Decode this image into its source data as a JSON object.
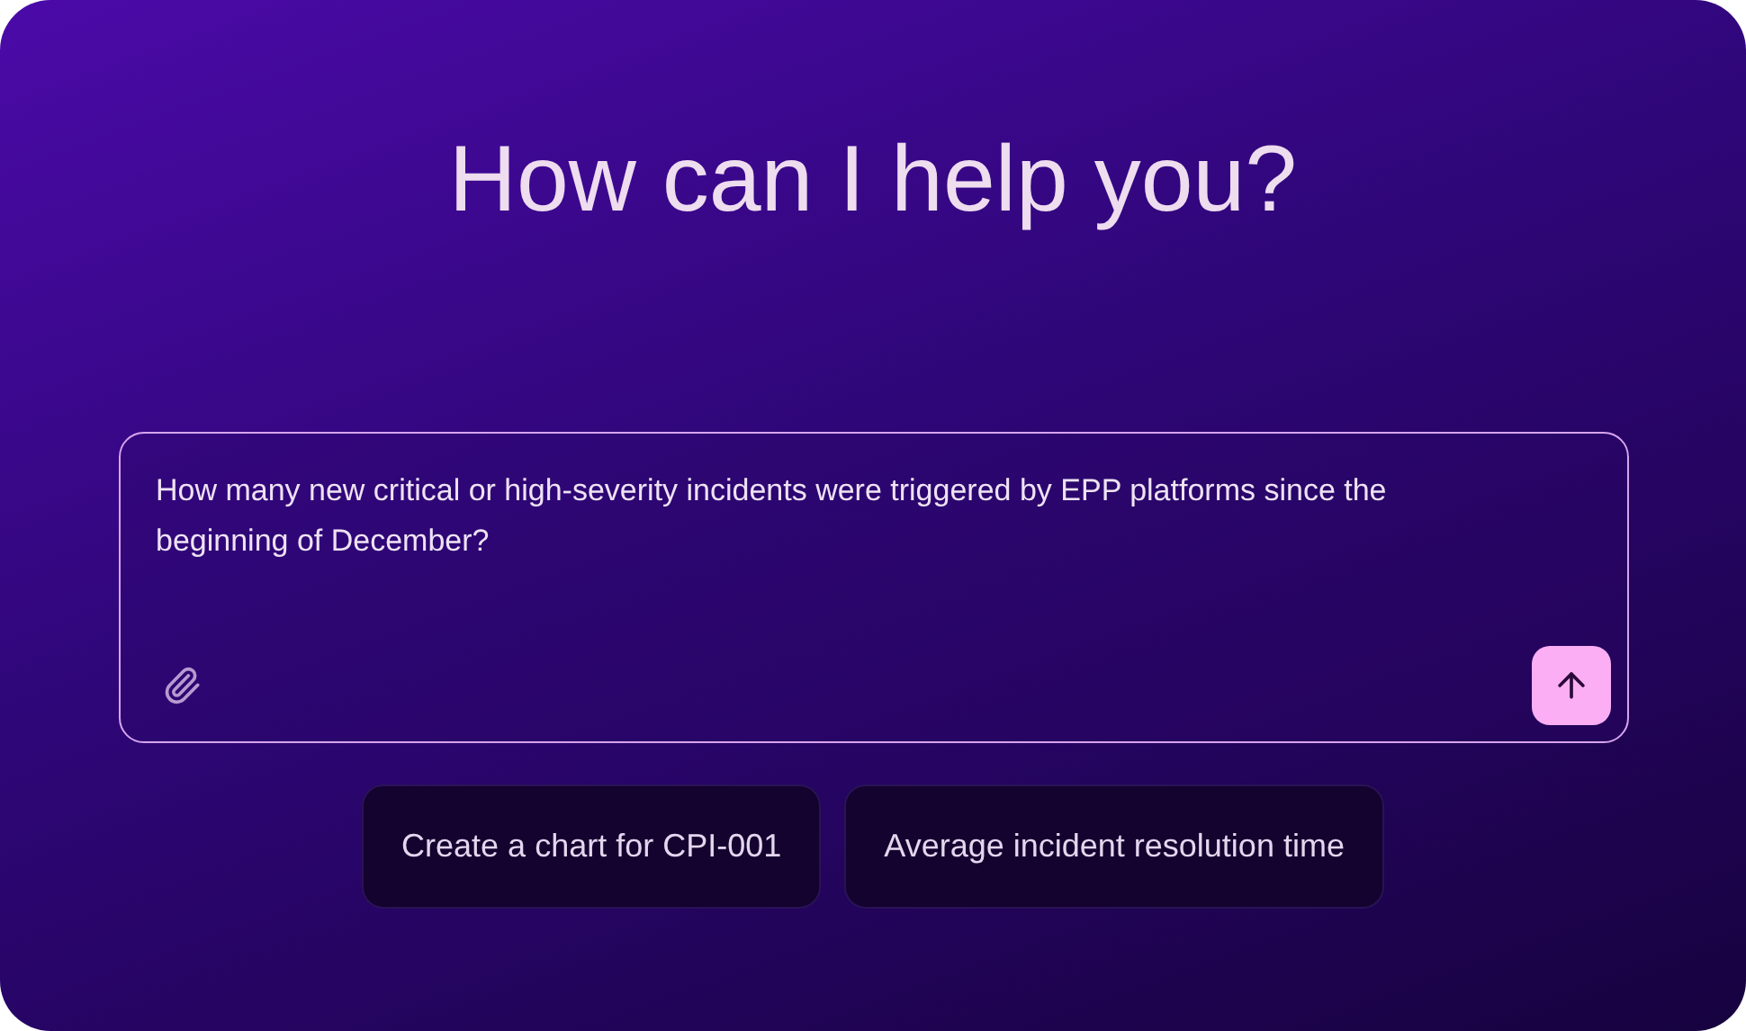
{
  "title": "How can I help you?",
  "prompt": {
    "value": "How many new critical or high-severity incidents were triggered by EPP platforms since the beginning of December?"
  },
  "suggestions": [
    "Create a chart for CPI-001",
    "Average incident resolution time"
  ]
}
